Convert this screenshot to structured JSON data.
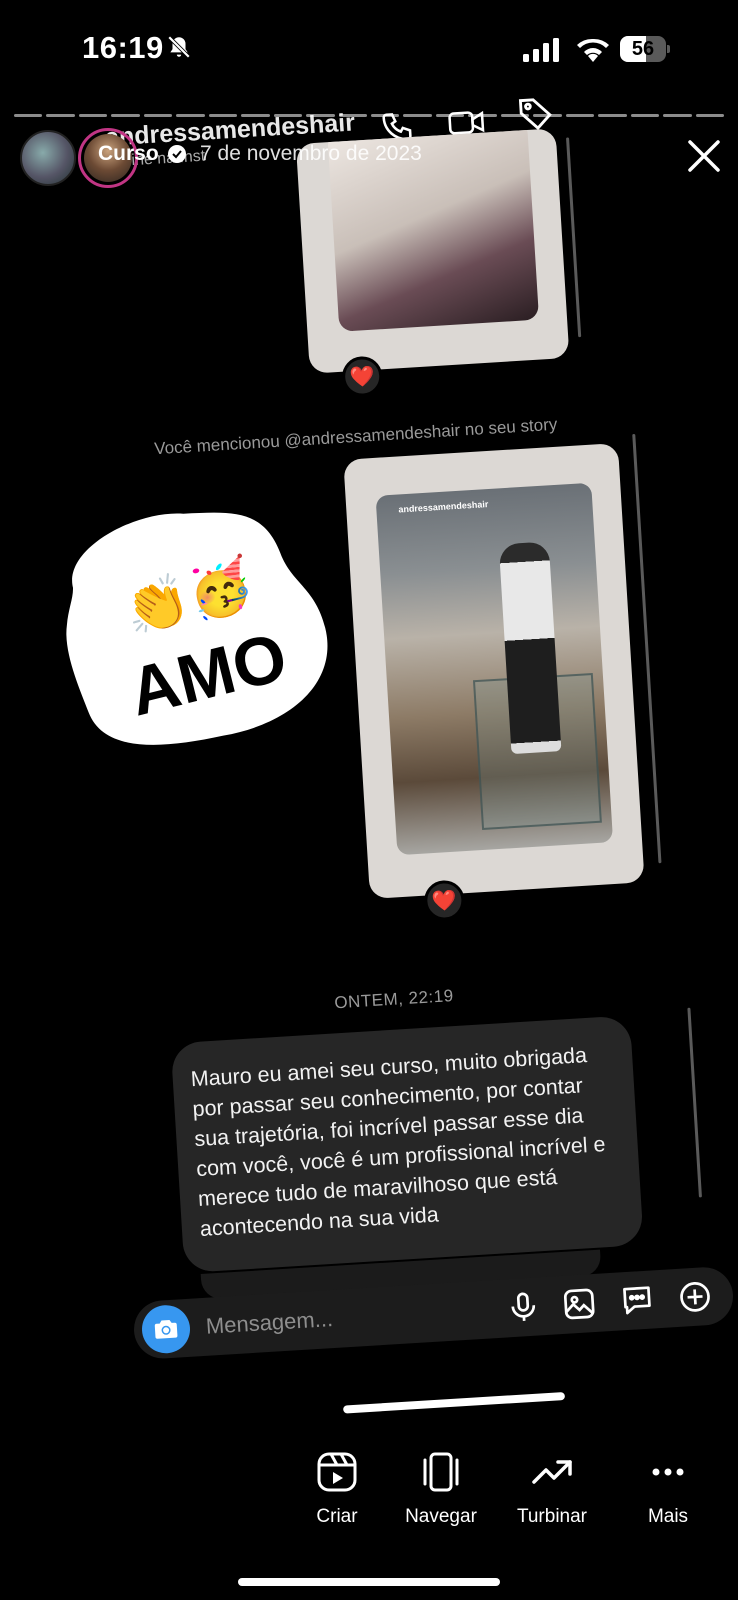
{
  "status_bar": {
    "time": "16:19",
    "battery": "56",
    "battery_level": 0.56
  },
  "story": {
    "user": "Curso",
    "date": "7 de novembro de 2023",
    "progress_segments": 22
  },
  "dm": {
    "username": "andressamendeshair",
    "online": "Online na Inst",
    "mention_text": "Você mencionou @andressamendeshair no seu story",
    "shared_story_handle": "andressamendeshair",
    "reaction_emoji": "❤️",
    "sticker_text": "AMO",
    "sticker_emojis": "👏🥳",
    "time_divider": "ONTEM, 22:19",
    "message": "Mauro eu amei seu curso, muito obrigada por passar seu conhecimento, por contar sua trajetória, foi incrível passar esse dia com você, você é um profissional incrível e merece tudo de maravilhoso que está acontecendo na sua vida",
    "composer_placeholder": "Mensagem..."
  },
  "toolbar": {
    "items": [
      {
        "label": "Criar",
        "icon": "reels-icon"
      },
      {
        "label": "Navegar",
        "icon": "browse-icon"
      },
      {
        "label": "Turbinar",
        "icon": "trend-up-icon"
      },
      {
        "label": "Mais",
        "icon": "more-icon"
      }
    ]
  }
}
